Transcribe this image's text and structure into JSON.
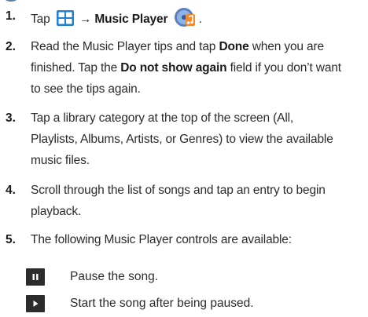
{
  "steps": [
    {
      "number": "1.",
      "parts": {
        "tap": "Tap",
        "arrow_label": "→ Music Player",
        "period": "."
      }
    },
    {
      "number": "2.",
      "lines": [
        [
          "Read the Music Player tips and tap ",
          "Done",
          " when you are"
        ],
        [
          "finished. Tap the ",
          "Do not show again",
          " field if you don’t want"
        ],
        [
          "to see the tips again."
        ]
      ]
    },
    {
      "number": "3.",
      "lines": [
        "Tap a library category at the top of the screen (All,",
        "Playlists, Albums, Artists, or Genres) to view the available",
        "music files."
      ]
    },
    {
      "number": "4.",
      "lines": [
        "Scroll through the list of songs and tap an entry to begin",
        "playback."
      ]
    },
    {
      "number": "5.",
      "lines": [
        "The following Music Player controls are available:"
      ]
    }
  ],
  "controls": [
    {
      "icon": "pause-icon",
      "text": "Pause the song."
    },
    {
      "icon": "play-icon",
      "text": "Start the song after being paused."
    }
  ],
  "colors": {
    "apps_icon_blue": "#1f7fd1",
    "music_icon_orange": "#f28a2b",
    "music_icon_blue": "#5b7fbf",
    "control_icon_bg": "#2c2c2c"
  }
}
